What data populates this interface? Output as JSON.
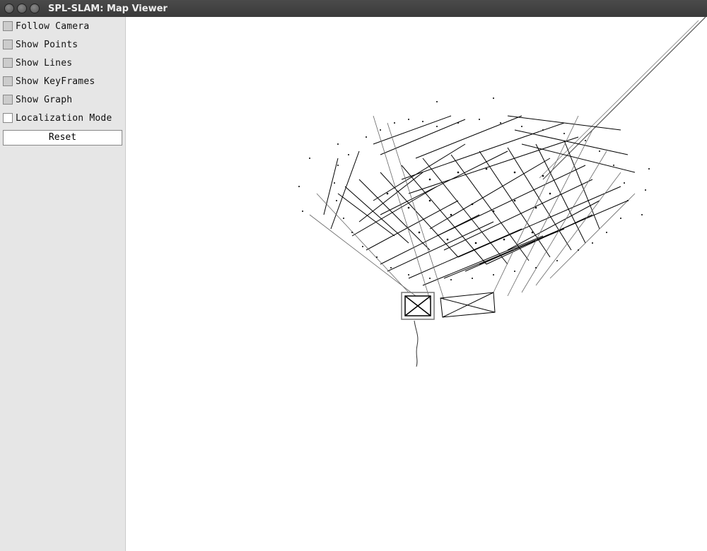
{
  "window": {
    "title": "SPL-SLAM: Map Viewer"
  },
  "sidebar": {
    "options": [
      {
        "id": "follow-camera",
        "label": "Follow Camera",
        "checked": true
      },
      {
        "id": "show-points",
        "label": "Show Points",
        "checked": true
      },
      {
        "id": "show-lines",
        "label": "Show Lines",
        "checked": true
      },
      {
        "id": "show-keyframes",
        "label": "Show KeyFrames",
        "checked": true
      },
      {
        "id": "show-graph",
        "label": "Show Graph",
        "checked": true
      },
      {
        "id": "localization-mode",
        "label": "Localization Mode",
        "checked": false
      }
    ],
    "reset_label": "Reset"
  },
  "viewer": {
    "description": "3D SLAM point cloud, feature lines, keyframe frustums and pose graph rendered in monochrome"
  }
}
